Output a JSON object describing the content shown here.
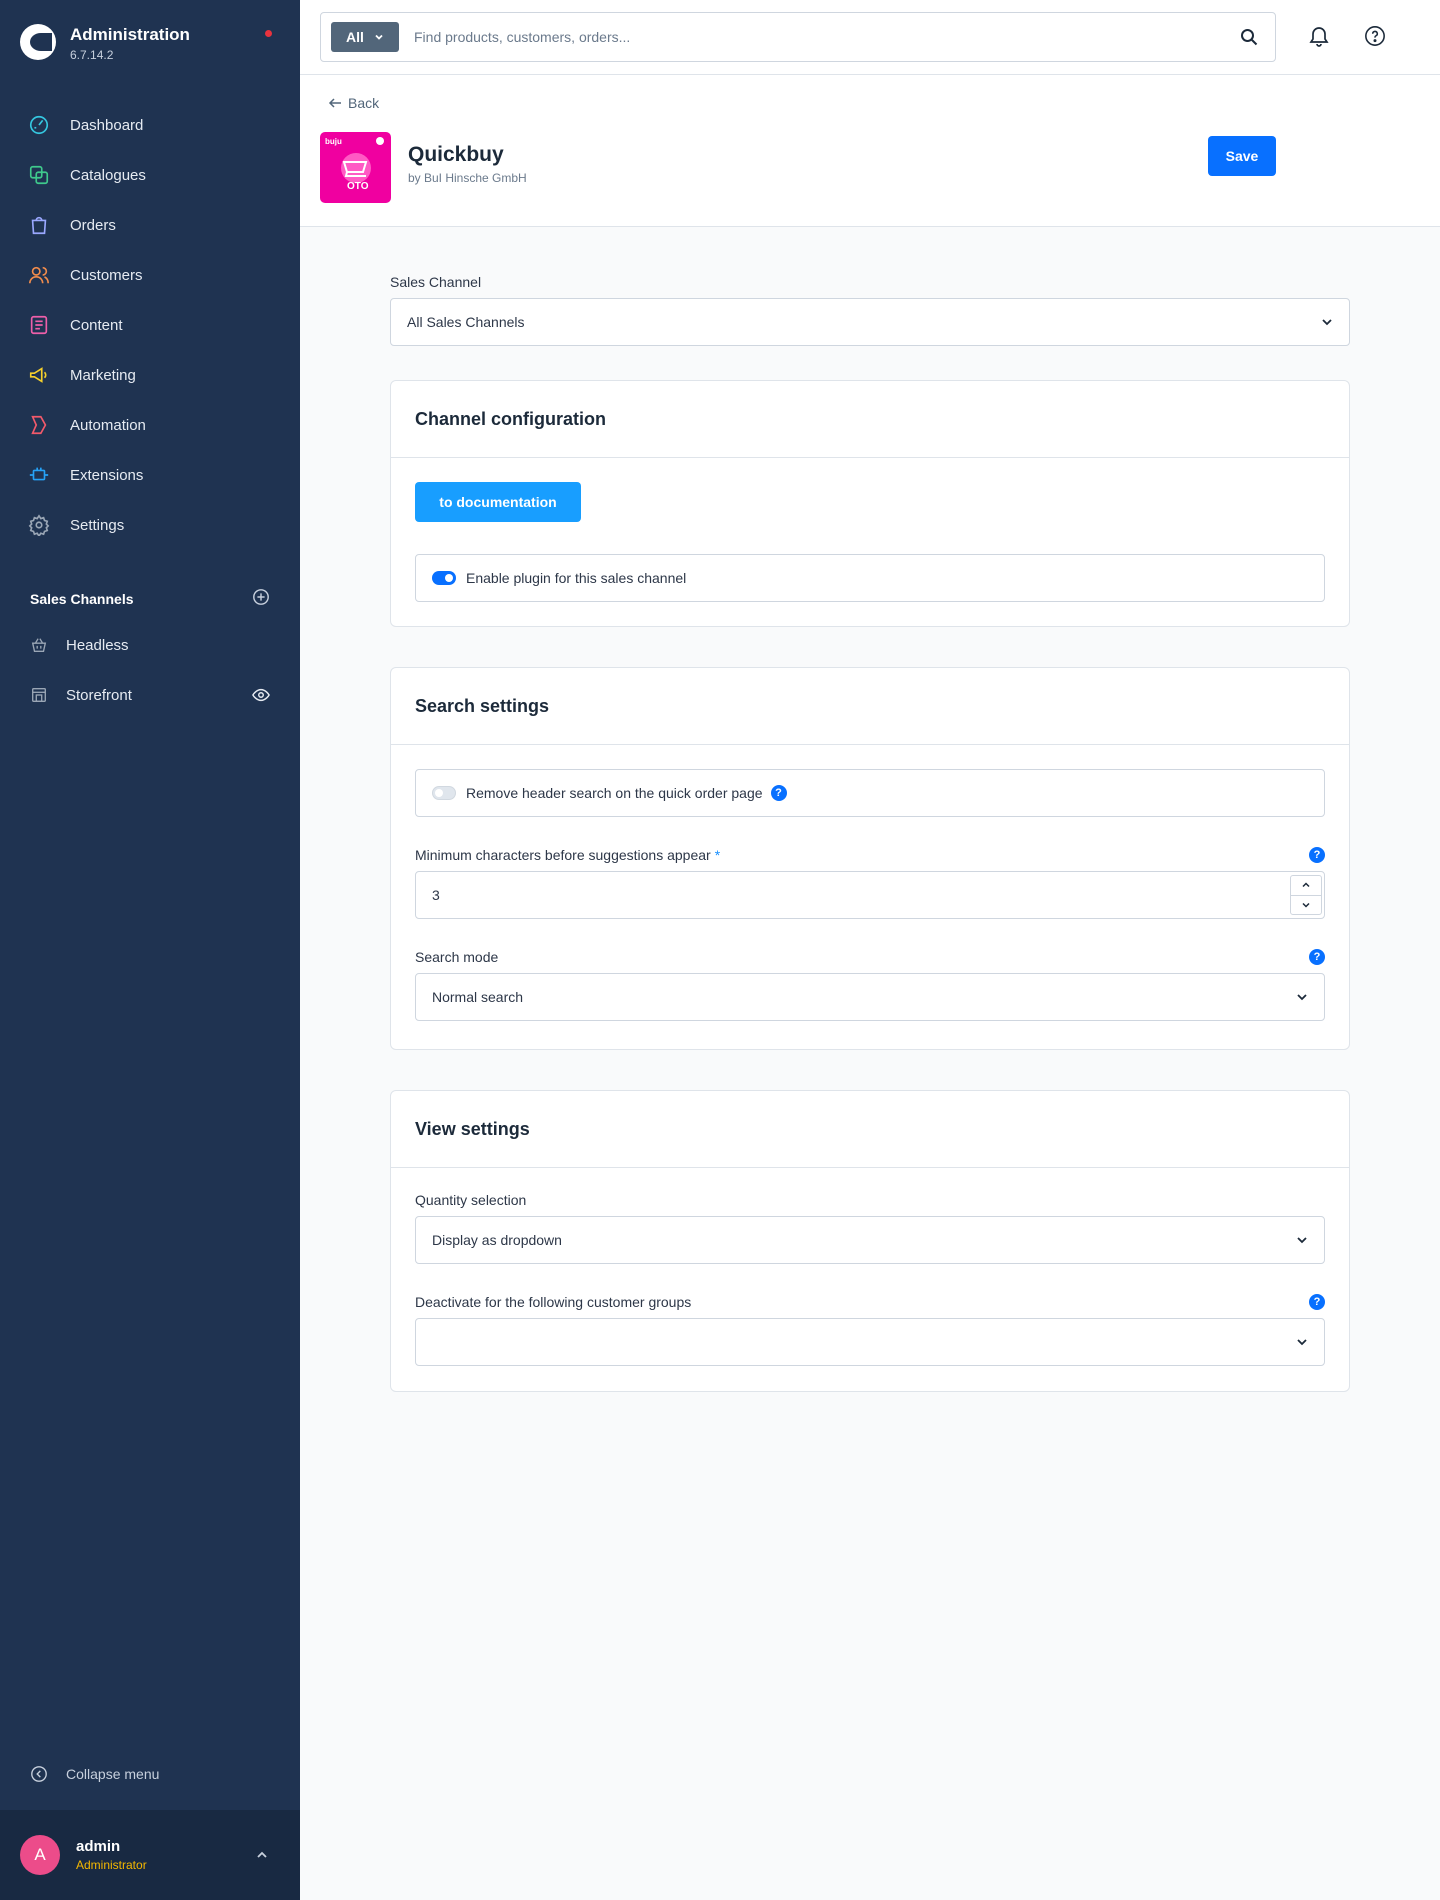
{
  "colors": {
    "sidebar": "#1f3351",
    "accent": "#0870ff",
    "doc_button": "#189eff",
    "plugin_icon": "#f000a0",
    "avatar": "#ec4c8a",
    "role": "#f5b800"
  },
  "brand": {
    "title": "Administration",
    "version": "6.7.14.2"
  },
  "nav": [
    {
      "label": "Dashboard",
      "icon": "dashboard-icon",
      "color": "#35c7e0"
    },
    {
      "label": "Catalogues",
      "icon": "catalogues-icon",
      "color": "#3fc98c"
    },
    {
      "label": "Orders",
      "icon": "orders-icon",
      "color": "#9aa8ff"
    },
    {
      "label": "Customers",
      "icon": "customers-icon",
      "color": "#f18c4c"
    },
    {
      "label": "Content",
      "icon": "content-icon",
      "color": "#ee5fa9"
    },
    {
      "label": "Marketing",
      "icon": "marketing-icon",
      "color": "#f5d02b"
    },
    {
      "label": "Automation",
      "icon": "automation-icon",
      "color": "#f25a6b"
    },
    {
      "label": "Extensions",
      "icon": "extensions-icon",
      "color": "#26a2f6"
    },
    {
      "label": "Settings",
      "icon": "settings-icon",
      "color": "#9aa6b5"
    }
  ],
  "sales_channels": {
    "title": "Sales Channels",
    "items": [
      {
        "label": "Headless",
        "icon": "basket-icon"
      },
      {
        "label": "Storefront",
        "icon": "storefront-icon"
      }
    ]
  },
  "collapse_label": "Collapse menu",
  "user": {
    "initial": "A",
    "name": "admin",
    "role": "Administrator"
  },
  "search": {
    "type": "All",
    "placeholder": "Find products, customers, orders..."
  },
  "page": {
    "back": "Back",
    "plugin_name": "Quickbuy",
    "plugin_by": "by BuI Hinsche GmbH",
    "save": "Save",
    "icon_text_top": "buju",
    "icon_text_mid": "OTO"
  },
  "sales_channel": {
    "label": "Sales Channel",
    "value": "All Sales Channels"
  },
  "channel_config": {
    "title": "Channel configuration",
    "doc_button": "to documentation",
    "enable_label": "Enable plugin for this sales channel",
    "enabled": true
  },
  "search_settings": {
    "title": "Search settings",
    "remove_header_label": "Remove header search on the quick order page",
    "remove_header_enabled": false,
    "min_chars_label": "Minimum characters before suggestions appear",
    "required_mark": "*",
    "min_chars_value": "3",
    "mode_label": "Search mode",
    "mode_value": "Normal search"
  },
  "view_settings": {
    "title": "View settings",
    "quantity_label": "Quantity selection",
    "quantity_value": "Display as dropdown",
    "deactivate_label": "Deactivate for the following customer groups",
    "deactivate_value": ""
  },
  "help_mark": "?"
}
